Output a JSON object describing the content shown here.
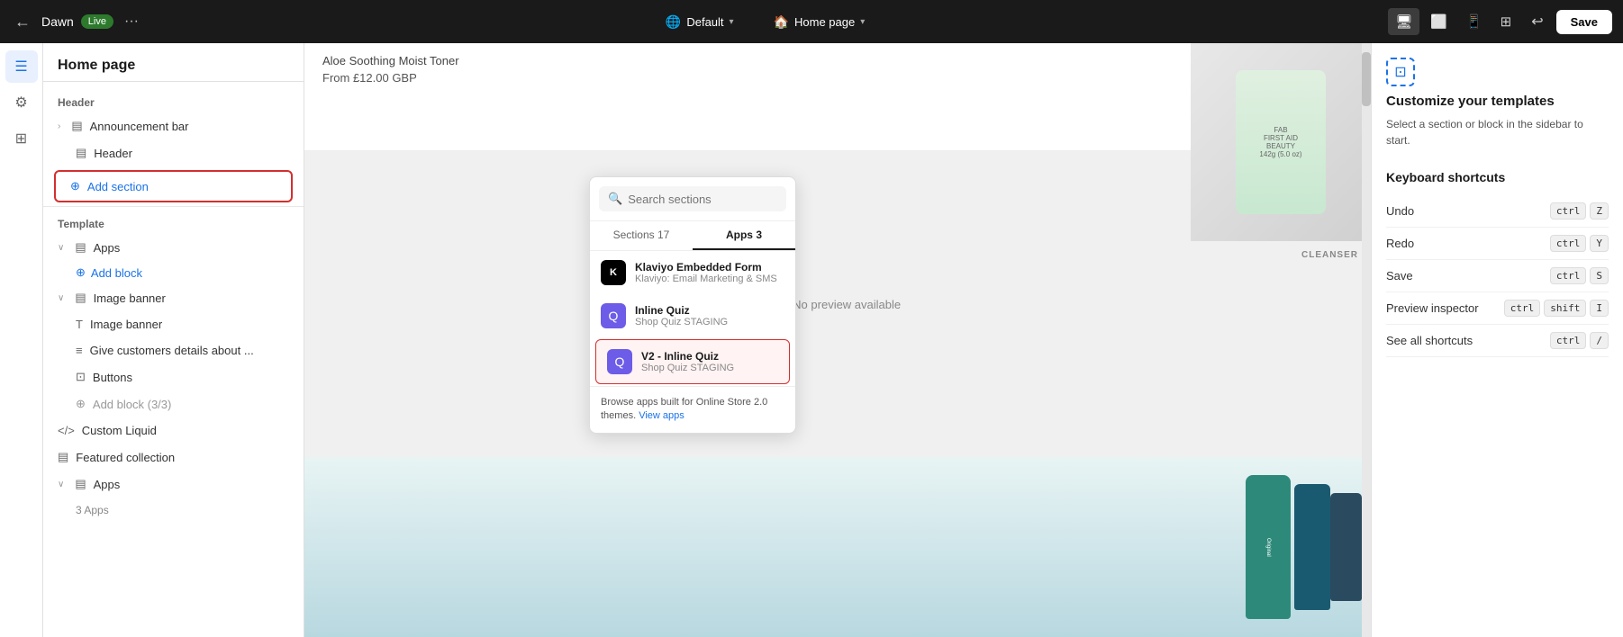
{
  "topnav": {
    "store_name": "Dawn",
    "live_label": "Live",
    "more_label": "···",
    "default_label": "Default",
    "homepage_label": "Home page",
    "save_label": "Save"
  },
  "sidebar": {
    "title": "Home page",
    "header_section_label": "Header",
    "announcement_bar_label": "Announcement bar",
    "header_label": "Header",
    "add_section_label": "Add section",
    "template_label": "Template",
    "apps_label": "Apps",
    "add_block_label": "Add block",
    "image_banner_label": "Image banner",
    "image_banner_sub_label": "Image banner",
    "give_customers_label": "Give customers details about ...",
    "buttons_label": "Buttons",
    "add_block_disabled_label": "Add block (3/3)",
    "custom_liquid_label": "Custom Liquid",
    "featured_collection_label": "Featured collection",
    "apps_bottom_label": "Apps",
    "apps_count_label": "3 Apps"
  },
  "popup": {
    "search_placeholder": "Search sections",
    "tab_sections_label": "Sections",
    "tab_sections_count": "17",
    "tab_apps_label": "Apps",
    "tab_apps_count": "3",
    "items": [
      {
        "name": "Klaviyo Embedded Form",
        "sub": "Klaviyo: Email Marketing & SMS",
        "icon_label": "K",
        "icon_type": "klaviyo"
      },
      {
        "name": "Inline Quiz",
        "sub": "Shop Quiz STAGING",
        "icon_label": "Q",
        "icon_type": "quiz"
      },
      {
        "name": "V2 - Inline Quiz",
        "sub": "Shop Quiz STAGING",
        "icon_label": "Q",
        "icon_type": "quiz",
        "selected": true
      }
    ],
    "footer_text": "Browse apps built for Online Store 2.0 themes.",
    "footer_link_label": "View apps"
  },
  "canvas": {
    "product_title": "Aloe Soothing Moist Toner",
    "product_price": "From £12.00 GBP",
    "cleanser_label": "CLEANSER",
    "no_preview_label": "No preview available"
  },
  "right_panel": {
    "title": "Customize your templates",
    "description": "Select a section or block in the sidebar to start.",
    "shortcuts_title": "Keyboard shortcuts",
    "shortcuts": [
      {
        "label": "Undo",
        "keys": [
          "ctrl",
          "Z"
        ]
      },
      {
        "label": "Redo",
        "keys": [
          "ctrl",
          "Y"
        ]
      },
      {
        "label": "Save",
        "keys": [
          "ctrl",
          "S"
        ]
      },
      {
        "label": "Preview inspector",
        "keys": [
          "ctrl",
          "shift",
          "I"
        ]
      },
      {
        "label": "See all shortcuts",
        "keys": [
          "ctrl",
          "/"
        ]
      }
    ]
  }
}
